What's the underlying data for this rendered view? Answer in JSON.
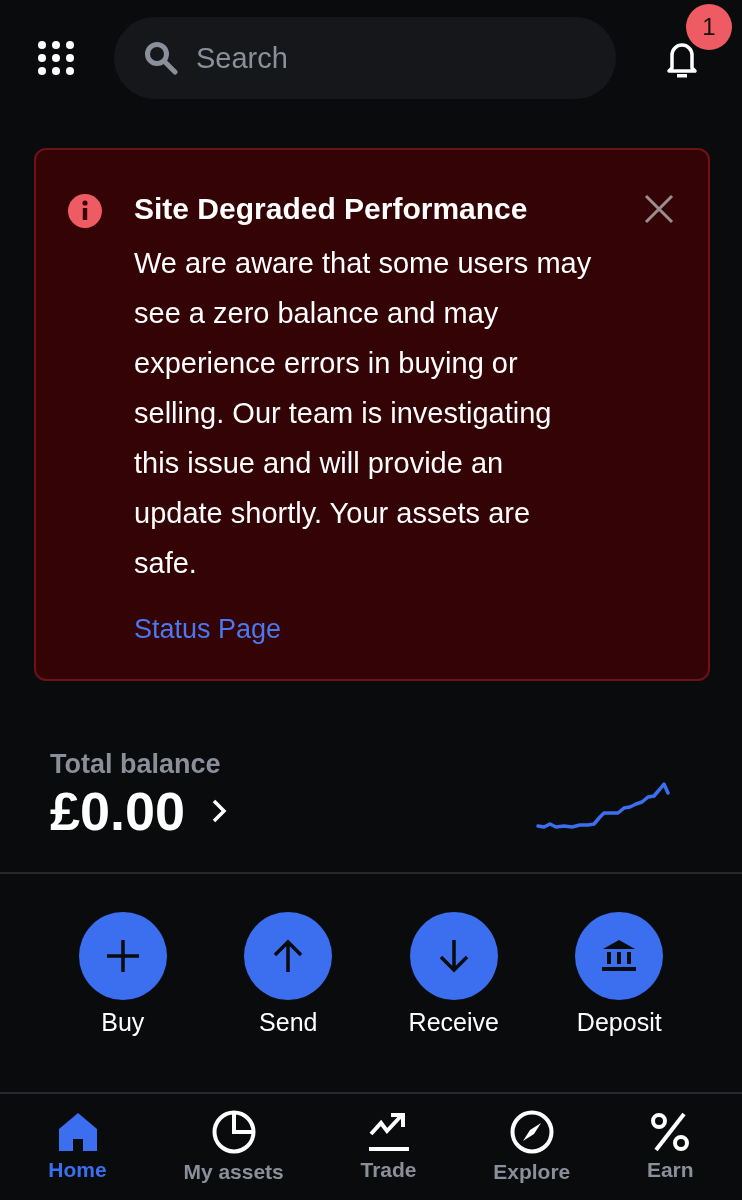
{
  "search": {
    "placeholder": "Search"
  },
  "notifications": {
    "badge": "1"
  },
  "alert": {
    "title": "Site Degraded Performance",
    "message": "We are aware that some users may see a zero balance and may experience errors in buying or selling. Our team is investigating this issue and will provide an update shortly. Your assets are safe.",
    "link": "Status Page"
  },
  "balance": {
    "label": "Total balance",
    "amount": "£0.00"
  },
  "actions": [
    {
      "kind": "buy",
      "label": "Buy"
    },
    {
      "kind": "send",
      "label": "Send"
    },
    {
      "kind": "receive",
      "label": "Receive"
    },
    {
      "kind": "deposit",
      "label": "Deposit"
    }
  ],
  "nav": [
    {
      "kind": "home",
      "label": "Home",
      "selected": true
    },
    {
      "kind": "assets",
      "label": "My assets",
      "selected": false
    },
    {
      "kind": "trade",
      "label": "Trade",
      "selected": false
    },
    {
      "kind": "explore",
      "label": "Explore",
      "selected": false
    },
    {
      "kind": "earn",
      "label": "Earn",
      "selected": false
    }
  ]
}
